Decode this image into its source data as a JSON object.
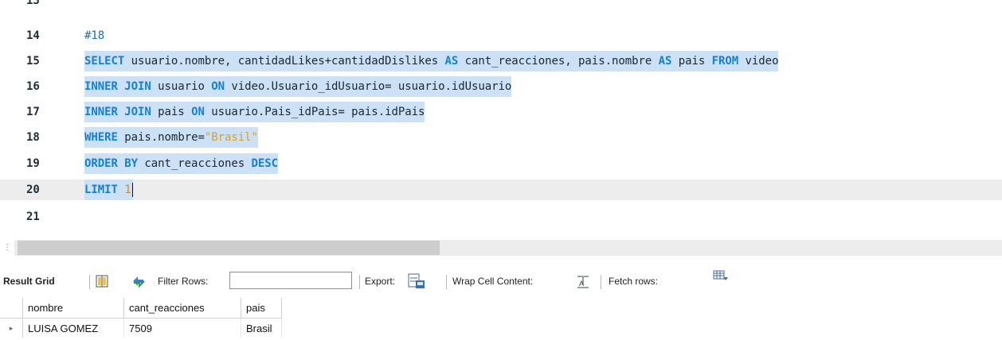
{
  "editor": {
    "lines": [
      {
        "num": "13",
        "segments": []
      },
      {
        "num": "14",
        "segments": [
          {
            "t": "#18",
            "c": "cm"
          }
        ]
      },
      {
        "num": "15",
        "sel": true,
        "segments": [
          {
            "t": "SELECT",
            "c": "kw"
          },
          {
            "t": " usuario.nombre, cantidadLikes+cantidadDislikes ",
            "c": ""
          },
          {
            "t": "AS",
            "c": "kw"
          },
          {
            "t": " cant_reacciones, pais.nombre ",
            "c": ""
          },
          {
            "t": "AS",
            "c": "kw"
          },
          {
            "t": " pais ",
            "c": ""
          },
          {
            "t": "FROM",
            "c": "kw"
          },
          {
            "t": " video",
            "c": ""
          }
        ]
      },
      {
        "num": "16",
        "sel": true,
        "segments": [
          {
            "t": "INNER JOIN",
            "c": "kw"
          },
          {
            "t": " usuario ",
            "c": ""
          },
          {
            "t": "ON",
            "c": "kw"
          },
          {
            "t": " video.Usuario_idUsuario= usuario.idUsuario",
            "c": ""
          }
        ]
      },
      {
        "num": "17",
        "sel": true,
        "segments": [
          {
            "t": "INNER JOIN",
            "c": "kw"
          },
          {
            "t": " pais ",
            "c": ""
          },
          {
            "t": "ON",
            "c": "kw"
          },
          {
            "t": " usuario.Pais_idPais= pais.idPais",
            "c": ""
          }
        ]
      },
      {
        "num": "18",
        "sel": true,
        "segments": [
          {
            "t": "WHERE",
            "c": "kw"
          },
          {
            "t": " pais.nombre=",
            "c": ""
          },
          {
            "t": "\"Brasil\"",
            "c": "str"
          }
        ]
      },
      {
        "num": "19",
        "sel": true,
        "segments": [
          {
            "t": "ORDER BY",
            "c": "kw"
          },
          {
            "t": " cant_reacciones ",
            "c": ""
          },
          {
            "t": "DESC",
            "c": "kw"
          }
        ]
      },
      {
        "num": "20",
        "sel": true,
        "current": true,
        "caret": true,
        "segments": [
          {
            "t": "LIMIT",
            "c": "kw"
          },
          {
            "t": " ",
            "c": ""
          },
          {
            "t": "1",
            "c": "num"
          }
        ]
      },
      {
        "num": "21",
        "segments": []
      }
    ]
  },
  "toolbar": {
    "result_grid_label": "Result Grid",
    "filter_label": "Filter Rows:",
    "filter_value": "",
    "export_label": "Export:",
    "wrap_label": "Wrap Cell Content:",
    "fetch_label": "Fetch rows:",
    "icons": [
      "grid-layout-icon",
      "refresh-arrows-icon",
      "export-icon",
      "wrap-cell-icon",
      "fetch-rows-icon"
    ]
  },
  "results": {
    "columns": [
      "nombre",
      "cant_reacciones",
      "pais"
    ],
    "rows": [
      [
        "LUISA GOMEZ",
        "7509",
        "Brasil"
      ]
    ]
  },
  "colors": {
    "keyword": "#1480d4",
    "selection": "#cce1f5",
    "string": "#d1a13b",
    "current_line": "#ededed"
  }
}
